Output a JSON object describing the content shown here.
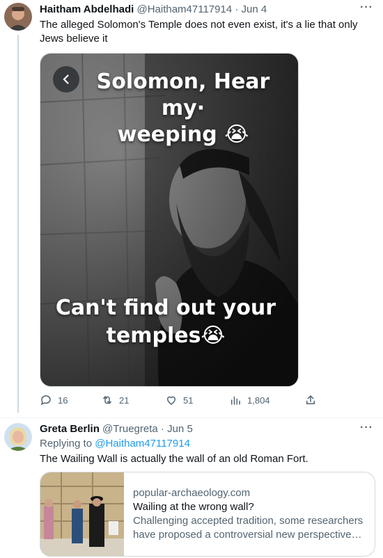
{
  "tweet1": {
    "author_name": "Haitham Abdelhadi",
    "handle": "@Haitham47117914",
    "separator": "·",
    "date": "Jun 4",
    "text": "The alleged Solomon's Temple does not even exist, it's a lie that only Jews believe it",
    "image_top_text_line1": "Solomon, Hear my·",
    "image_top_text_line2": "weeping 😭",
    "image_bottom_text_line1": "Can't find out your",
    "image_bottom_text_line2": "temples😭",
    "stats": {
      "replies": "16",
      "retweets": "21",
      "likes": "51",
      "views": "1,804"
    }
  },
  "tweet2": {
    "author_name": "Greta Berlin",
    "handle": "@Truegreta",
    "separator": "·",
    "date": "Jun 5",
    "replying_label": "Replying to",
    "replying_to": "@Haitham47117914",
    "text": "The Wailing Wall is actually the wall of an old Roman Fort.",
    "card": {
      "domain": "popular-archaeology.com",
      "title": "Wailing at the wrong wall?",
      "description": "Challenging accepted tradition, some researchers have proposed a controversial new perspective on..."
    }
  },
  "icons": {
    "more": "more-icon",
    "reply": "reply-icon",
    "retweet": "retweet-icon",
    "like": "like-icon",
    "views": "views-icon",
    "share": "share-icon",
    "back": "chevron-left-icon"
  },
  "colors": {
    "accent": "#1d9bf0",
    "muted": "#536471",
    "border": "#cfd9de",
    "text": "#0f1419"
  }
}
